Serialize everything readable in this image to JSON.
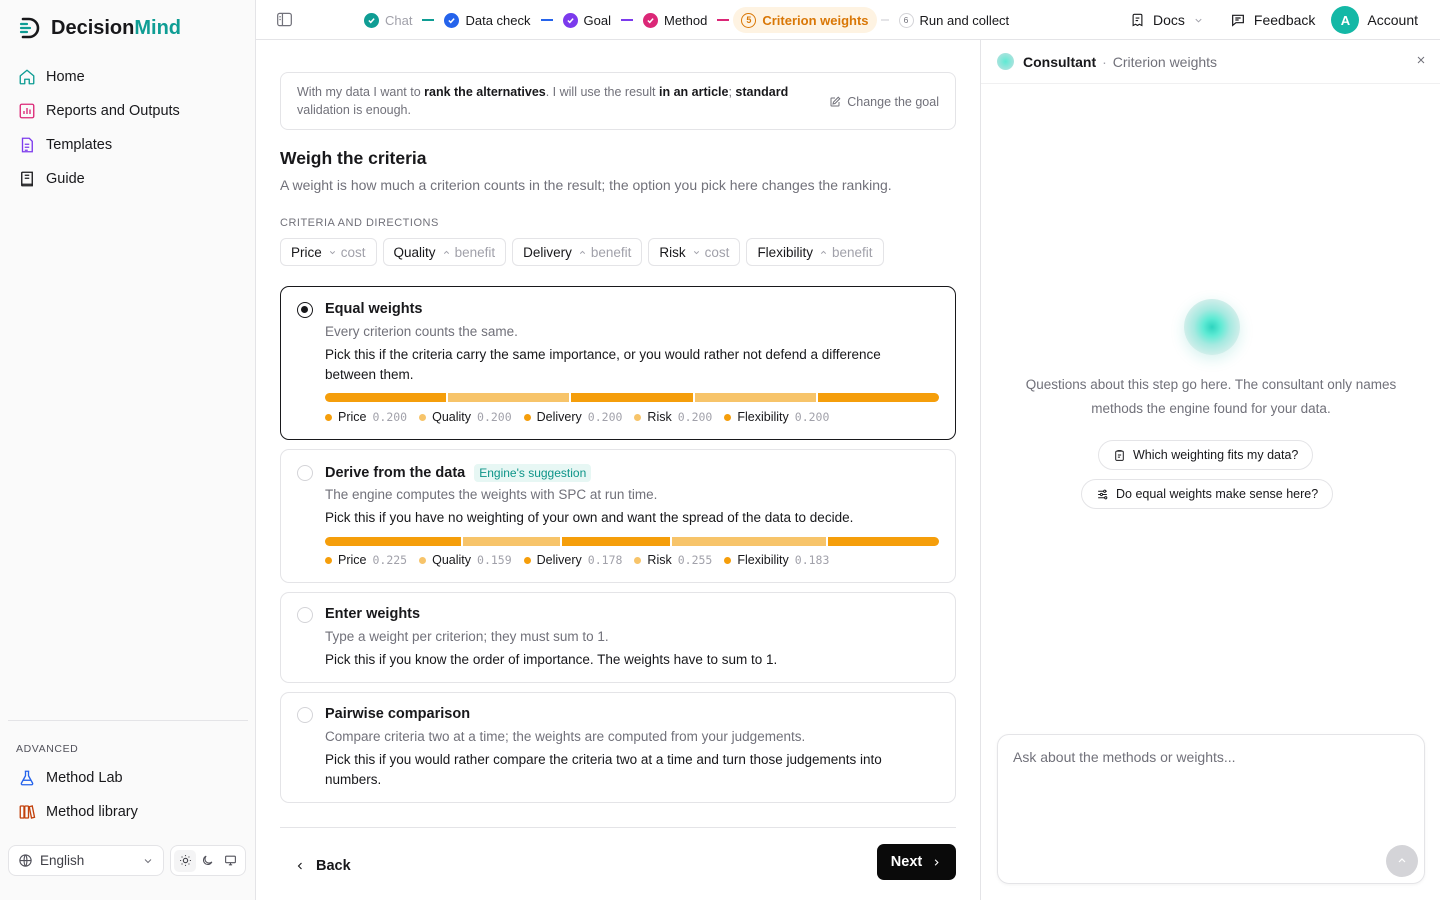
{
  "brand": {
    "name_part1": "Decision",
    "name_part2": "Mind"
  },
  "sidebar": {
    "items": [
      {
        "label": "Home",
        "icon": "home-icon"
      },
      {
        "label": "Reports and Outputs",
        "icon": "chart-icon"
      },
      {
        "label": "Templates",
        "icon": "template-icon"
      },
      {
        "label": "Guide",
        "icon": "book-icon"
      }
    ],
    "advanced_label": "ADVANCED",
    "advanced_items": [
      {
        "label": "Method Lab",
        "icon": "flask-icon"
      },
      {
        "label": "Method library",
        "icon": "library-icon"
      }
    ],
    "language": "English"
  },
  "steps": [
    {
      "label": "Chat",
      "state": "done-muted"
    },
    {
      "label": "Data check",
      "state": "done"
    },
    {
      "label": "Goal",
      "state": "done"
    },
    {
      "label": "Method",
      "state": "done"
    },
    {
      "label": "Criterion weights",
      "state": "active",
      "number": "5"
    },
    {
      "label": "Run and collect",
      "state": "pending",
      "number": "6"
    }
  ],
  "topbar": {
    "docs": "Docs",
    "feedback": "Feedback",
    "account": "Account",
    "avatar": "A"
  },
  "goal": {
    "t1": "With my data I want to ",
    "b1": "rank the alternatives",
    "t2": ". I will use the result ",
    "b2": "in an article",
    "t3": "; ",
    "b3": "standard",
    "t4": " validation is enough.",
    "change": "Change the goal"
  },
  "main": {
    "title": "Weigh the criteria",
    "subtitle": "A weight is how much a criterion counts in the result; the option you pick here changes the ranking.",
    "criteria_label": "CRITERIA AND DIRECTIONS",
    "criteria": [
      {
        "name": "Price",
        "direction": "cost"
      },
      {
        "name": "Quality",
        "direction": "benefit"
      },
      {
        "name": "Delivery",
        "direction": "benefit"
      },
      {
        "name": "Risk",
        "direction": "cost"
      },
      {
        "name": "Flexibility",
        "direction": "benefit"
      }
    ],
    "options": [
      {
        "title": "Equal weights",
        "desc": "Every criterion counts the same.",
        "pick": "Pick this if the criteria carry the same importance, or you would rather not defend a difference between them.",
        "selected": true,
        "weights": [
          {
            "name": "Price",
            "value": "0.200"
          },
          {
            "name": "Quality",
            "value": "0.200"
          },
          {
            "name": "Delivery",
            "value": "0.200"
          },
          {
            "name": "Risk",
            "value": "0.200"
          },
          {
            "name": "Flexibility",
            "value": "0.200"
          }
        ]
      },
      {
        "title": "Derive from the data",
        "badge": "Engine's suggestion",
        "desc": "The engine computes the weights with SPC at run time.",
        "pick": "Pick this if you have no weighting of your own and want the spread of the data to decide.",
        "selected": false,
        "weights": [
          {
            "name": "Price",
            "value": "0.225"
          },
          {
            "name": "Quality",
            "value": "0.159"
          },
          {
            "name": "Delivery",
            "value": "0.178"
          },
          {
            "name": "Risk",
            "value": "0.255"
          },
          {
            "name": "Flexibility",
            "value": "0.183"
          }
        ]
      },
      {
        "title": "Enter weights",
        "desc": "Type a weight per criterion; they must sum to 1.",
        "pick": "Pick this if you know the order of importance. The weights have to sum to 1.",
        "selected": false
      },
      {
        "title": "Pairwise comparison",
        "desc": "Compare criteria two at a time; the weights are computed from your judgements.",
        "pick": "Pick this if you would rather compare the criteria two at a time and turn those judgements into numbers.",
        "selected": false
      }
    ],
    "back": "Back",
    "next": "Next"
  },
  "colors": {
    "weight_dark": "#f59e0b",
    "weight_light": "#f7c46a",
    "accent": "#0f9d94",
    "active_step": "#d97706"
  },
  "panel": {
    "title": "Consultant",
    "context": "Criterion weights",
    "hint": "Questions about this step go here. The consultant only names methods the engine found for your data.",
    "suggestions": [
      {
        "label": "Which weighting fits my data?",
        "icon": "clipboard-icon"
      },
      {
        "label": "Do equal weights make sense here?",
        "icon": "sliders-icon"
      }
    ],
    "placeholder": "Ask about the methods or weights..."
  }
}
